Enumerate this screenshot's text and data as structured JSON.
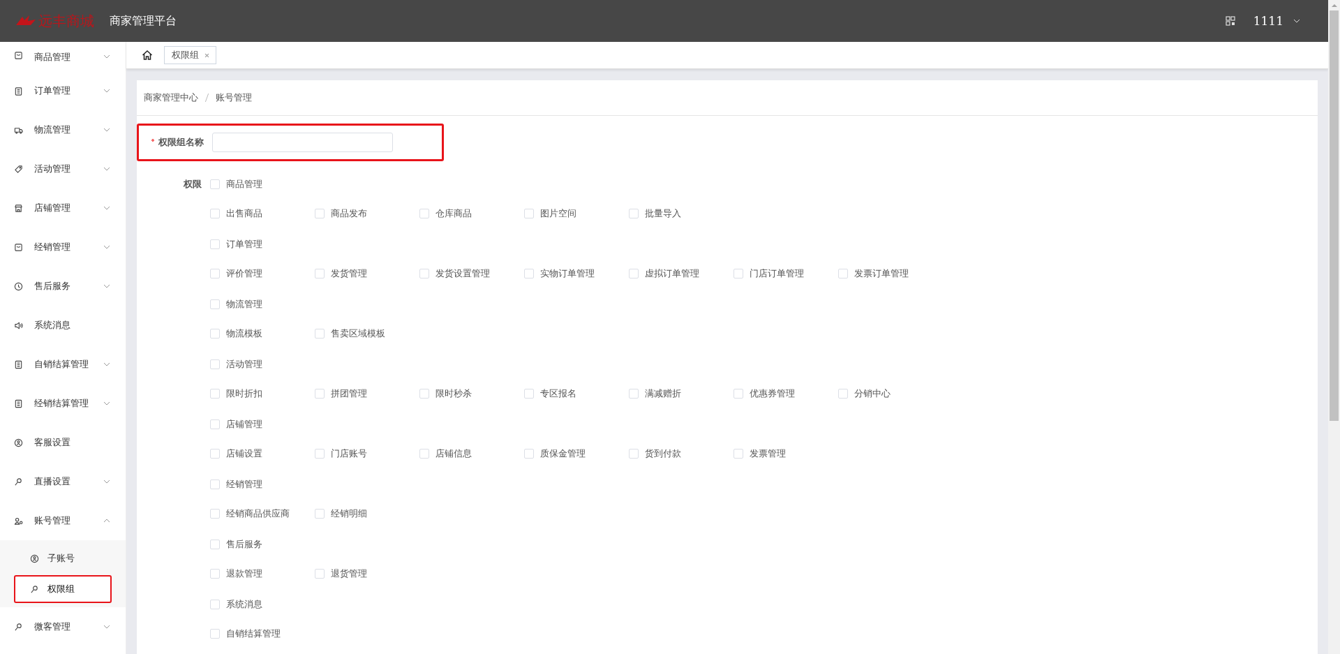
{
  "header": {
    "logo_text": "远丰商城",
    "title": "商家管理平台",
    "user": "1111"
  },
  "sidebar": {
    "items": [
      {
        "label": "商品管理",
        "kind": "box",
        "expandable": true,
        "expanded": false
      },
      {
        "label": "订单管理",
        "kind": "clipboard",
        "expandable": true,
        "expanded": false
      },
      {
        "label": "物流管理",
        "kind": "truck",
        "expandable": true,
        "expanded": false
      },
      {
        "label": "活动管理",
        "kind": "tag",
        "expandable": true,
        "expanded": false
      },
      {
        "label": "店铺管理",
        "kind": "shop",
        "expandable": true,
        "expanded": false
      },
      {
        "label": "经销管理",
        "kind": "box",
        "expandable": true,
        "expanded": false
      },
      {
        "label": "售后服务",
        "kind": "clock",
        "expandable": true,
        "expanded": false
      },
      {
        "label": "系统消息",
        "kind": "speaker",
        "expandable": false
      },
      {
        "label": "自销结算管理",
        "kind": "doc",
        "expandable": true,
        "expanded": false
      },
      {
        "label": "经销结算管理",
        "kind": "doc",
        "expandable": true,
        "expanded": false
      },
      {
        "label": "客服设置",
        "kind": "person",
        "expandable": false
      },
      {
        "label": "直播设置",
        "kind": "pin",
        "expandable": true,
        "expanded": false
      },
      {
        "label": "账号管理",
        "kind": "users",
        "expandable": true,
        "expanded": true,
        "children": [
          {
            "label": "子账号",
            "kind": "person",
            "selected": false,
            "highlighted": false
          },
          {
            "label": "权限组",
            "kind": "pin",
            "selected": true,
            "highlighted": true
          }
        ]
      },
      {
        "label": "微客管理",
        "kind": "pin",
        "expandable": true,
        "expanded": false
      }
    ]
  },
  "tabs": [
    {
      "label": "权限组",
      "selected": true
    }
  ],
  "breadcrumb": [
    "商家管理中心",
    "账号管理"
  ],
  "form": {
    "name_field": {
      "label": "权限组名称",
      "required": true,
      "highlighted": true
    },
    "permissions_label": "权限",
    "permissions": [
      {
        "label": "商品管理",
        "checked": false,
        "children": [
          {
            "label": "出售商品",
            "checked": false
          },
          {
            "label": "商品发布",
            "checked": false
          },
          {
            "label": "仓库商品",
            "checked": false
          },
          {
            "label": "图片空间",
            "checked": false
          },
          {
            "label": "批量导入",
            "checked": false
          }
        ]
      },
      {
        "label": "订单管理",
        "checked": false,
        "children": [
          {
            "label": "评价管理",
            "checked": false
          },
          {
            "label": "发货管理",
            "checked": false
          },
          {
            "label": "发货设置管理",
            "checked": false
          },
          {
            "label": "实物订单管理",
            "checked": false
          },
          {
            "label": "虚拟订单管理",
            "checked": false
          },
          {
            "label": "门店订单管理",
            "checked": false
          },
          {
            "label": "发票订单管理",
            "checked": false
          }
        ]
      },
      {
        "label": "物流管理",
        "checked": false,
        "children": [
          {
            "label": "物流模板",
            "checked": false
          },
          {
            "label": "售卖区域模板",
            "checked": false
          }
        ]
      },
      {
        "label": "活动管理",
        "checked": false,
        "children": [
          {
            "label": "限时折扣",
            "checked": false
          },
          {
            "label": "拼团管理",
            "checked": false
          },
          {
            "label": "限时秒杀",
            "checked": false
          },
          {
            "label": "专区报名",
            "checked": false
          },
          {
            "label": "满减赠折",
            "checked": false
          },
          {
            "label": "优惠券管理",
            "checked": false
          },
          {
            "label": "分销中心",
            "checked": false
          }
        ]
      },
      {
        "label": "店铺管理",
        "checked": false,
        "children": [
          {
            "label": "店铺设置",
            "checked": false
          },
          {
            "label": "门店账号",
            "checked": false
          },
          {
            "label": "店铺信息",
            "checked": false
          },
          {
            "label": "质保金管理",
            "checked": false
          },
          {
            "label": "货到付款",
            "checked": false
          },
          {
            "label": "发票管理",
            "checked": false
          }
        ]
      },
      {
        "label": "经销管理",
        "checked": false,
        "children": [
          {
            "label": "经销商品供应商",
            "checked": false
          },
          {
            "label": "经销明细",
            "checked": false
          }
        ]
      },
      {
        "label": "售后服务",
        "checked": false,
        "children": [
          {
            "label": "退款管理",
            "checked": false
          },
          {
            "label": "退货管理",
            "checked": false
          }
        ]
      },
      {
        "label": "系统消息",
        "checked": false
      },
      {
        "label": "自销结算管理",
        "checked": false
      }
    ]
  }
}
